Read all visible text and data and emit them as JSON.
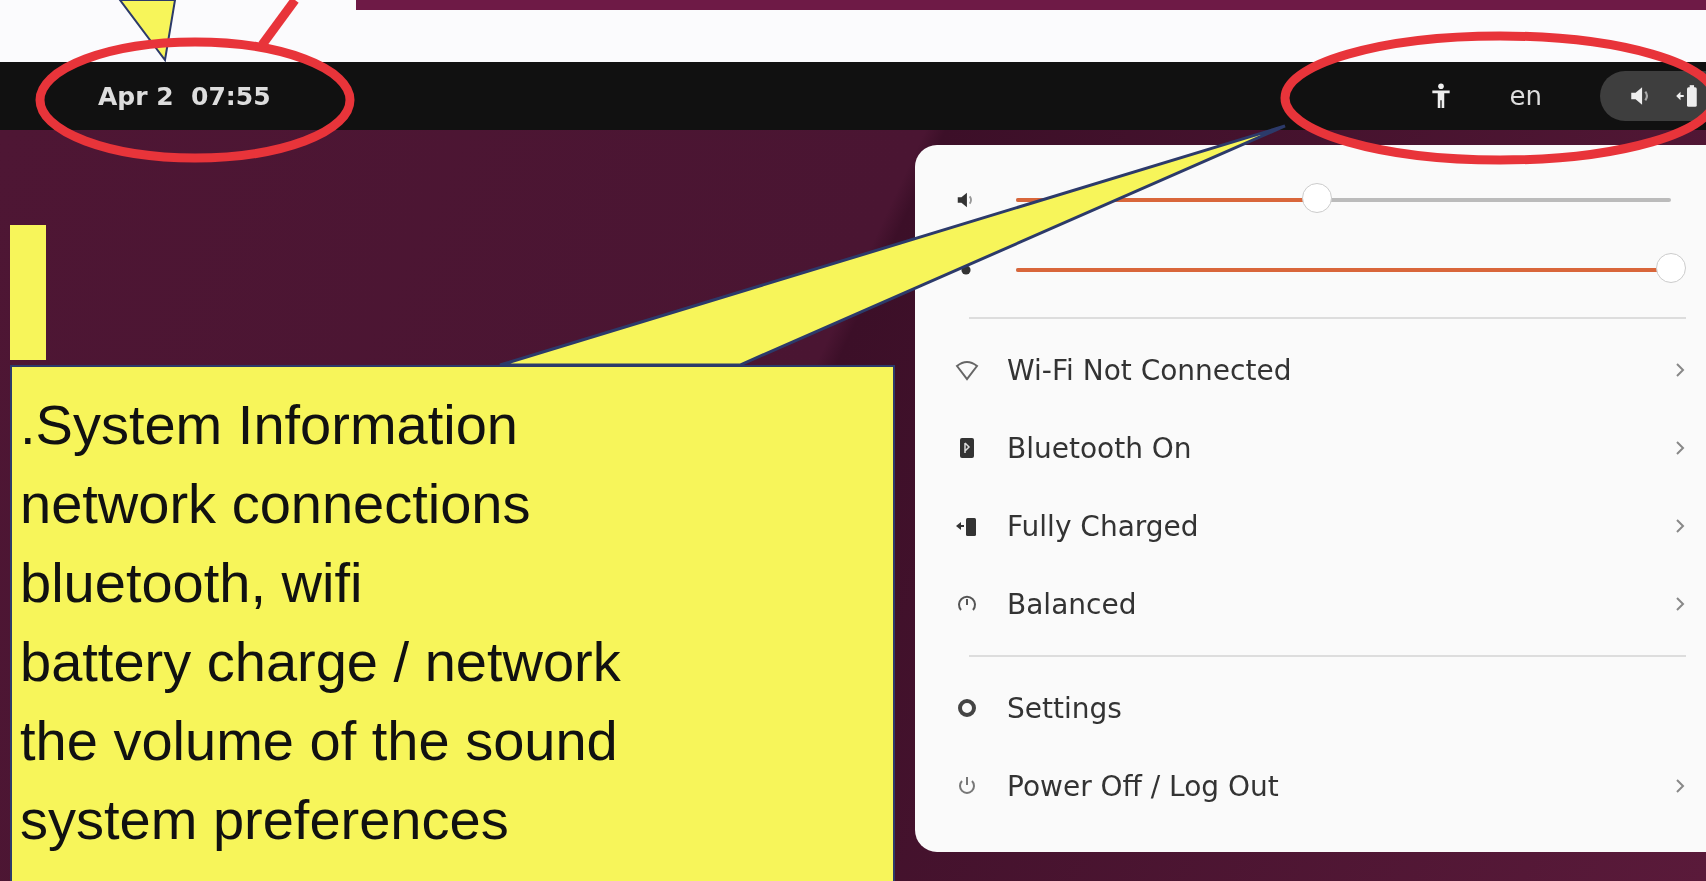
{
  "top_bar": {
    "date_time": "Apr 2  07:55",
    "language": "en",
    "status_icons": [
      {
        "kind": "volume"
      },
      {
        "kind": "battery"
      }
    ]
  },
  "quick_settings": {
    "sliders": [
      {
        "kind": "volume",
        "level": 0.46
      },
      {
        "kind": "brightness",
        "level": 1
      }
    ],
    "items": [
      {
        "kind": "wifi",
        "label": "Wi-Fi Not Connected",
        "submenu": true
      },
      {
        "kind": "bluetooth",
        "label": "Bluetooth On",
        "submenu": true
      },
      {
        "kind": "battery",
        "label": "Fully Charged",
        "submenu": true
      },
      {
        "kind": "power-mode",
        "label": "Balanced",
        "submenu": true
      },
      {
        "kind": "settings",
        "label": "Settings",
        "submenu": false
      },
      {
        "kind": "power",
        "label": "Power Off / Log Out",
        "submenu": true
      }
    ]
  },
  "callout": {
    "lines": [
      ".System Information",
      "network connections",
      "bluetooth, wifi",
      "battery charge / network",
      "the volume of the sound",
      "system preferences"
    ]
  }
}
